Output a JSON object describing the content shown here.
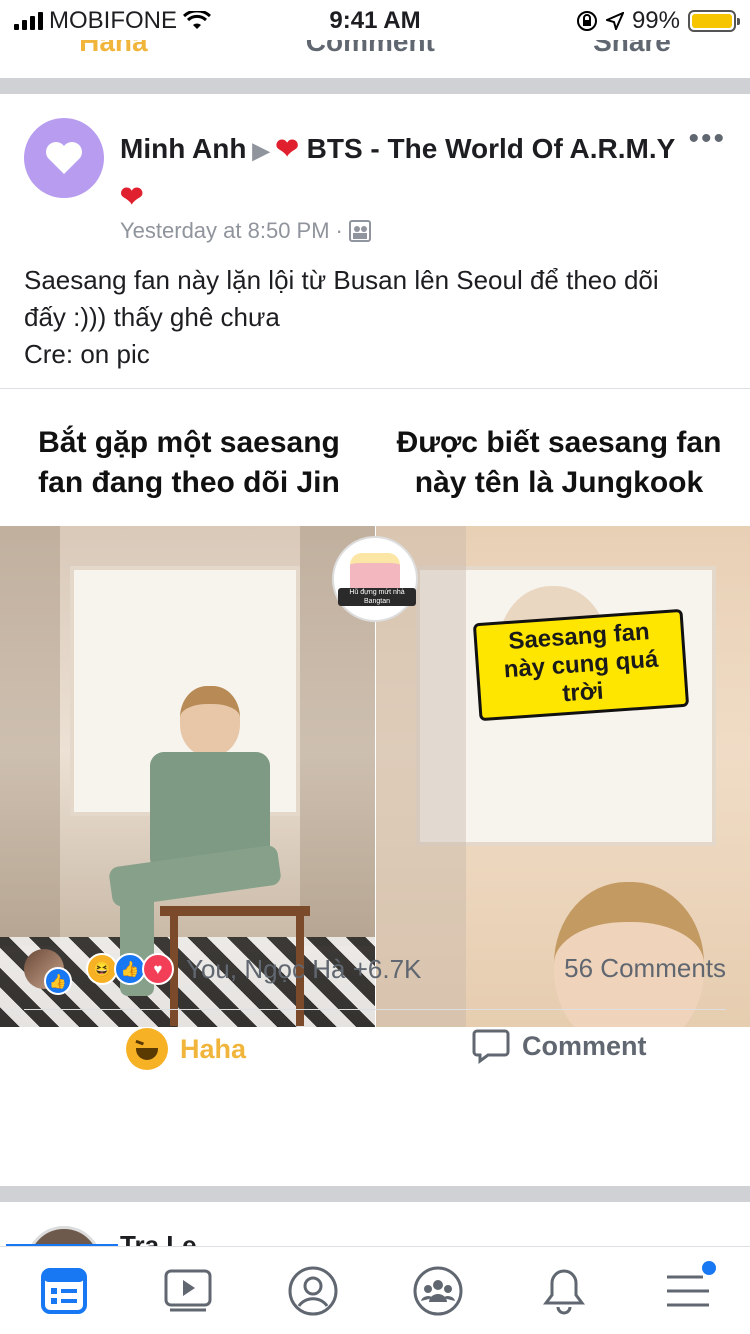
{
  "status_bar": {
    "carrier": "MOBIFONE",
    "time": "9:41 AM",
    "battery": "99%"
  },
  "previous_post": {
    "actions": [
      "Haha",
      "Comment",
      "Share"
    ]
  },
  "post": {
    "author": "Minh Anh",
    "group": "BTS - The World Of A.R.M.Y",
    "timestamp": "Yesterday at 8:50 PM",
    "separator": "·",
    "more": "•••",
    "text_lines": [
      "Saesang fan này lặn lội từ Busan lên Seoul để theo dõi",
      "đấy :))) thấy ghê chưa",
      "Cre: on pic"
    ],
    "image": {
      "caption_left": "Bắt gặp một saesang fan đang theo dõi Jin",
      "caption_right": "Được biết saesang fan này tên là Jungkook",
      "sticker_text": "Saesang fan này cung quá trời",
      "jar_label": "Hũ đựng mứt nhà Bangtan"
    },
    "reactions": {
      "names": "You, Ngọc Hà +6.7K",
      "comments": "56 Comments"
    },
    "actions": {
      "haha": "Haha",
      "comment": "Comment"
    }
  },
  "next_post": {
    "author_partial": "Tra Le"
  },
  "tab_bar": {
    "items": [
      "news-feed",
      "watch",
      "profile",
      "groups",
      "notifications",
      "menu"
    ],
    "active": "news-feed",
    "accent": "#1877f2"
  }
}
